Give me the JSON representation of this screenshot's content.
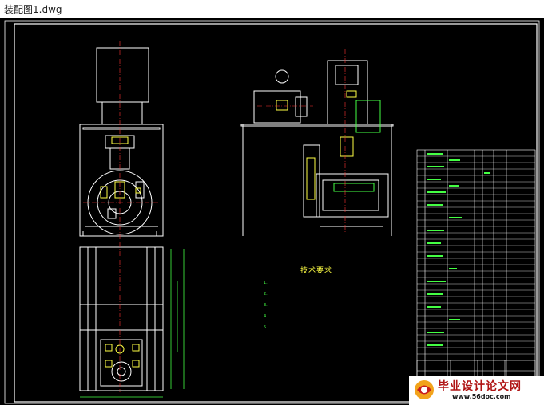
{
  "window": {
    "title": "装配图1.dwg"
  },
  "drawing": {
    "notes_heading": "技术要求",
    "notes": [
      "1.",
      "2.",
      "3.",
      "4.",
      "5."
    ]
  },
  "watermark": {
    "text": "毕业设计论文网",
    "url": "www.56doc.com"
  },
  "colors": {
    "background": "#000000",
    "outline": "#ffffff",
    "dimension": "#44ff44",
    "centerline": "#ff3333",
    "highlight": "#ffff44",
    "table_line": "#ffffff",
    "table_text": "#44ff44"
  }
}
